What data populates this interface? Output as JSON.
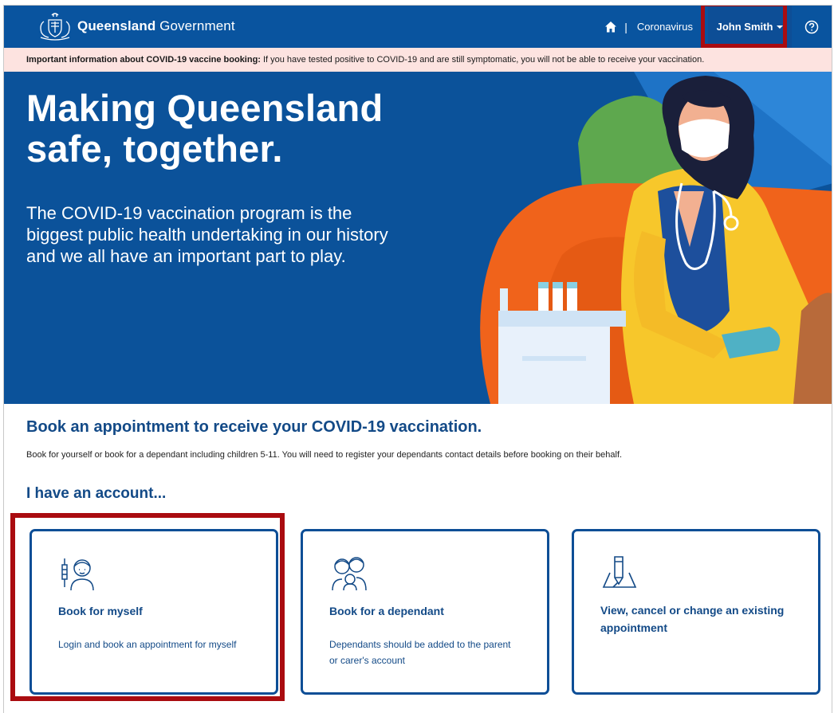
{
  "header": {
    "brand_bold": "Queensland",
    "brand_light": "Government",
    "home_icon": "home-icon",
    "separator": "|",
    "coronavirus_link": "Coronavirus",
    "user_name": "John Smith",
    "help_icon": "help-icon"
  },
  "alert": {
    "bold": "Important information about COVID-19 vaccine booking:",
    "text": "If you have tested positive to COVID-19 and are still symptomatic, you will not be able to receive your vaccination."
  },
  "hero": {
    "heading": "Making Queensland safe, together.",
    "body": "The COVID-19 vaccination program is the biggest public health undertaking in our history and we all have an important part to play."
  },
  "booking": {
    "title": "Book an appointment to receive your COVID-19 vaccination.",
    "description": "Book for yourself or book for a dependant including children 5-11. You will need to register your dependants contact details before booking on their behalf.",
    "subtitle": "I have an account..."
  },
  "cards": [
    {
      "icon": "vaccination-person-icon",
      "title": "Book for myself",
      "description": "Login and book an appointment for myself"
    },
    {
      "icon": "family-icon",
      "title": "Book for a dependant",
      "description": "Dependants should be added to the parent or carer's account"
    },
    {
      "icon": "edit-appointment-icon",
      "title": "View, cancel or change an existing appointment",
      "description": ""
    }
  ],
  "colors": {
    "brand_blue": "#09549f",
    "heading_blue": "#134a87",
    "alert_bg": "#fde3e0",
    "highlight_red": "#aa0c10"
  }
}
